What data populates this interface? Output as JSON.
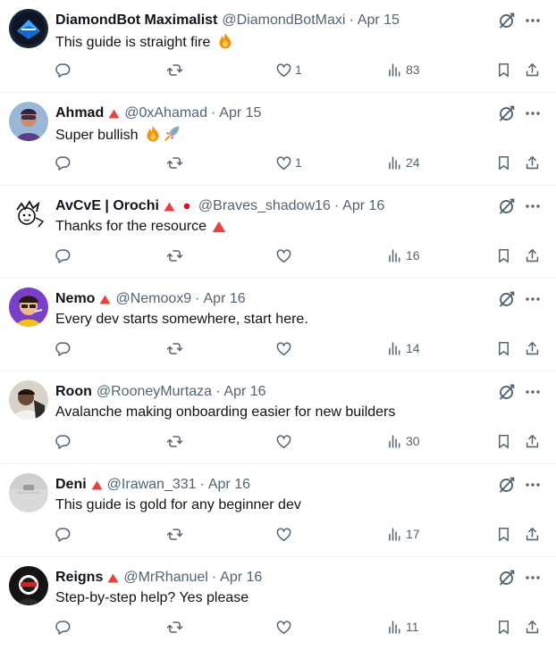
{
  "colors": {
    "text": "#0f1419",
    "muted": "#536471",
    "badge": "#e84142",
    "divider": "#eff3f4"
  },
  "replies": [
    {
      "name": "DiamondBot Maximalist",
      "handle": "@DiamondBotMaxi",
      "date": "Apr 15",
      "text": "This guide is straight fire",
      "emoji": [
        "fire"
      ],
      "badge": false,
      "flag": false,
      "likes": "1",
      "views": "83",
      "avatar": "diamondbot-avatar"
    },
    {
      "name": "Ahmad",
      "handle": "@0xAhamad",
      "date": "Apr 15",
      "text": "Super bullish",
      "emoji": [
        "fire",
        "rocket"
      ],
      "badge": true,
      "flag": false,
      "likes": "1",
      "views": "24",
      "avatar": "ahmad-avatar"
    },
    {
      "name": "AvCvE | Orochi",
      "handle": "@Braves_shadow16",
      "date": "Apr 16",
      "text": "Thanks for the resource",
      "emoji": [
        "avax-triangle"
      ],
      "badge": true,
      "flag": true,
      "likes": "",
      "views": "16",
      "avatar": "orochi-avatar"
    },
    {
      "name": "Nemo",
      "handle": "@Nemoox9",
      "date": "Apr 16",
      "text": "Every dev starts somewhere, start here.",
      "emoji": [],
      "badge": true,
      "flag": false,
      "likes": "",
      "views": "14",
      "avatar": "nemo-avatar"
    },
    {
      "name": "Roon",
      "handle": "@RooneyMurtaza",
      "date": "Apr 16",
      "text": "Avalanche making onboarding easier for new builders",
      "emoji": [],
      "badge": false,
      "flag": false,
      "likes": "",
      "views": "30",
      "avatar": "roon-avatar"
    },
    {
      "name": "Deni",
      "handle": "@Irawan_331",
      "date": "Apr 16",
      "text": "This guide is gold for any beginner dev",
      "emoji": [],
      "badge": true,
      "flag": false,
      "likes": "",
      "views": "17",
      "avatar": "deni-avatar"
    },
    {
      "name": "Reigns",
      "handle": "@MrRhanuel",
      "date": "Apr 16",
      "text": "Step-by-step help? Yes please",
      "emoji": [],
      "badge": true,
      "flag": false,
      "likes": "",
      "views": "11",
      "avatar": "reigns-avatar"
    }
  ]
}
